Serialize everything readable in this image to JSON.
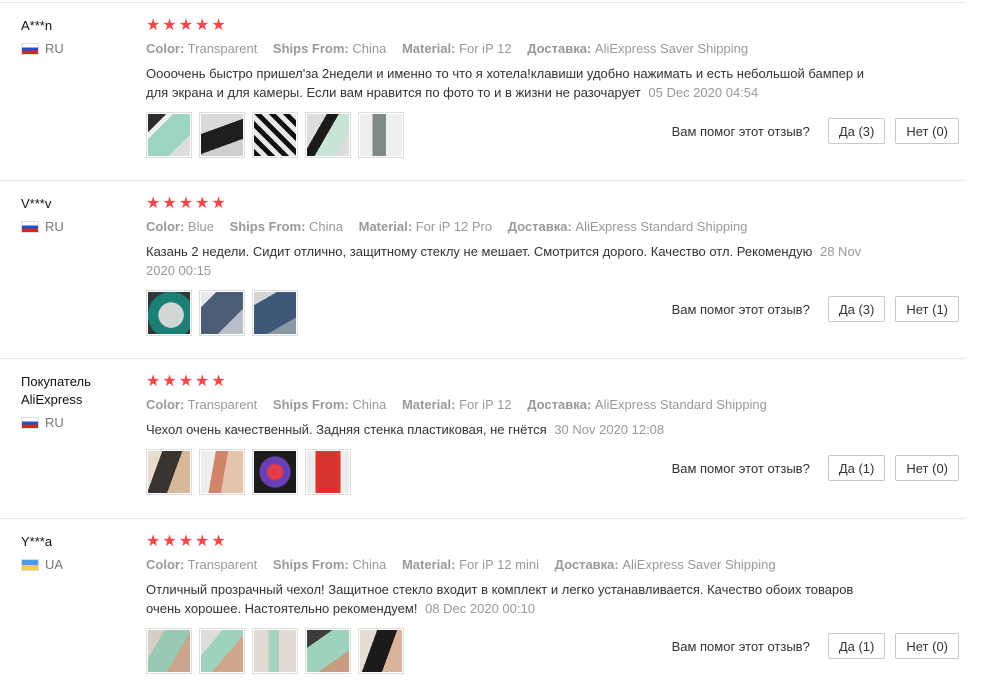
{
  "labels": {
    "color": "Color:",
    "ships_from": "Ships From:",
    "material": "Material:",
    "delivery": "Доставка:",
    "helpful_question": "Вам помог этот отзыв?"
  },
  "colors": {
    "star": "#f2474b",
    "muted": "#999999",
    "border": "#c9c9c9"
  },
  "reviews": [
    {
      "user": "A***n",
      "country": "RU",
      "flag_icon": "flag-ru-icon",
      "rating": 5,
      "color": "Transparent",
      "ships_from": "China",
      "material": "For iP 12",
      "delivery": "AliExpress Saver Shipping",
      "text": "Оооочень быстро пришел'за 2недели и именно то что я хотела!клавиши удобно нажимать и есть небольшой бампер и для экрана и для камеры. Если вам нравится по фото то и в жизни не разочарует",
      "date": "05 Dec 2020 04:54",
      "yes": "Да (3)",
      "no": "Нет (0)"
    },
    {
      "user": "V***v",
      "country": "RU",
      "flag_icon": "flag-ru-icon",
      "rating": 5,
      "color": "Blue",
      "ships_from": "China",
      "material": "For iP 12 Pro",
      "delivery": "AliExpress Standard Shipping",
      "text": "Казань 2 недели. Сидит отлично, защитному стеклу не мешает. Смотрится дорого. Качество отл. Рекомендую",
      "date": "28 Nov 2020 00:15",
      "yes": "Да (3)",
      "no": "Нет (1)"
    },
    {
      "user": "Покупатель AliExpress",
      "country": "RU",
      "flag_icon": "flag-ru-icon",
      "rating": 5,
      "color": "Transparent",
      "ships_from": "China",
      "material": "For iP 12",
      "delivery": "AliExpress Standard Shipping",
      "text": "Чехол очень качественный. Задняя стенка пластиковая, не гнётся",
      "date": "30 Nov 2020 12:08",
      "yes": "Да (1)",
      "no": "Нет (0)"
    },
    {
      "user": "Y***a",
      "country": "UA",
      "flag_icon": "flag-ua-icon",
      "rating": 5,
      "color": "Transparent",
      "ships_from": "China",
      "material": "For iP 12 mini",
      "delivery": "AliExpress Saver Shipping",
      "text": "Отличный прозрачный чехол! Защитное стекло входит в комплект и легко устанавливается. Качество обоих товаров очень хорошее. Настоятельно рекомендуем!",
      "date": "08 Dec 2020 00:10",
      "yes": "Да (1)",
      "no": "Нет (0)"
    }
  ]
}
